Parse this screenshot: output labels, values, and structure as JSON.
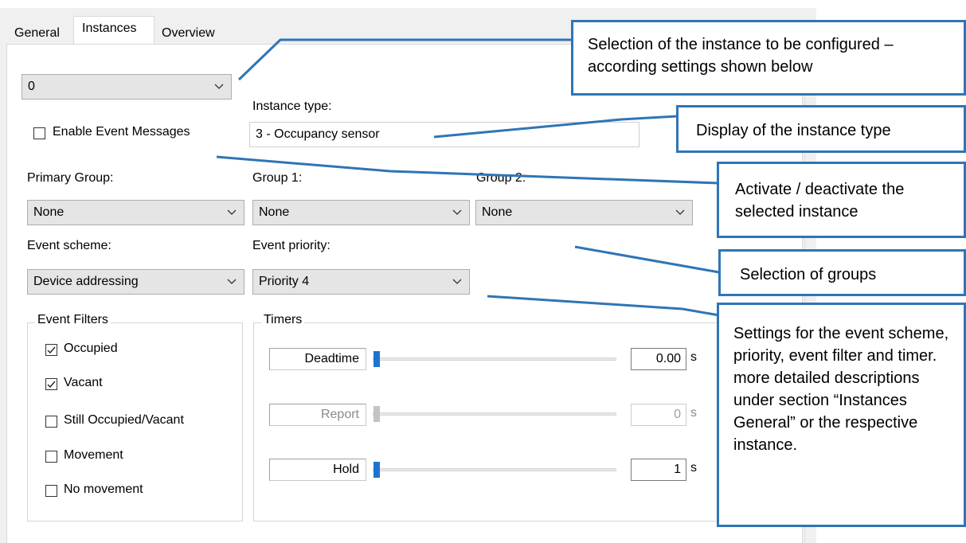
{
  "tabs": [
    {
      "label": "General"
    },
    {
      "label": "Instances"
    },
    {
      "label": "Overview"
    }
  ],
  "instance_select": {
    "value": "0"
  },
  "instance_type": {
    "label": "Instance type:",
    "value": "3 - Occupancy sensor"
  },
  "enable_event_messages": {
    "label": "Enable Event Messages",
    "checked": false
  },
  "groups": {
    "primary": {
      "label": "Primary Group:",
      "value": "None"
    },
    "group1": {
      "label": "Group 1:",
      "value": "None"
    },
    "group2": {
      "label": "Group 2:",
      "value": "None"
    }
  },
  "event_scheme": {
    "label": "Event scheme:",
    "value": "Device addressing"
  },
  "event_priority": {
    "label": "Event priority:",
    "value": "Priority 4"
  },
  "event_filters": {
    "title": "Event Filters",
    "items": [
      {
        "label": "Occupied",
        "checked": true
      },
      {
        "label": "Vacant",
        "checked": true
      },
      {
        "label": "Still Occupied/Vacant",
        "checked": false
      },
      {
        "label": "Movement",
        "checked": false
      },
      {
        "label": "No movement",
        "checked": false
      }
    ]
  },
  "timers": {
    "title": "Timers",
    "items": [
      {
        "label": "Deadtime",
        "value": "0.00",
        "unit": "s",
        "enabled": true
      },
      {
        "label": "Report",
        "value": "0",
        "unit": "s",
        "enabled": false
      },
      {
        "label": "Hold",
        "value": "1",
        "unit": "s",
        "enabled": true
      }
    ]
  },
  "callouts": {
    "instance_selection": "Selection of the instance to be configured – according settings shown below",
    "instance_type": "Display of the instance type",
    "activate": "Activate / deactivate the selected instance",
    "groups": "Selection of groups",
    "settings": "Settings for the event scheme, priority, event filter and timer. more detailed descriptions under section “Instances General” or the respective instance."
  },
  "colors": {
    "accent": "#2e75b6",
    "slider_thumb": "#1e73d2"
  }
}
